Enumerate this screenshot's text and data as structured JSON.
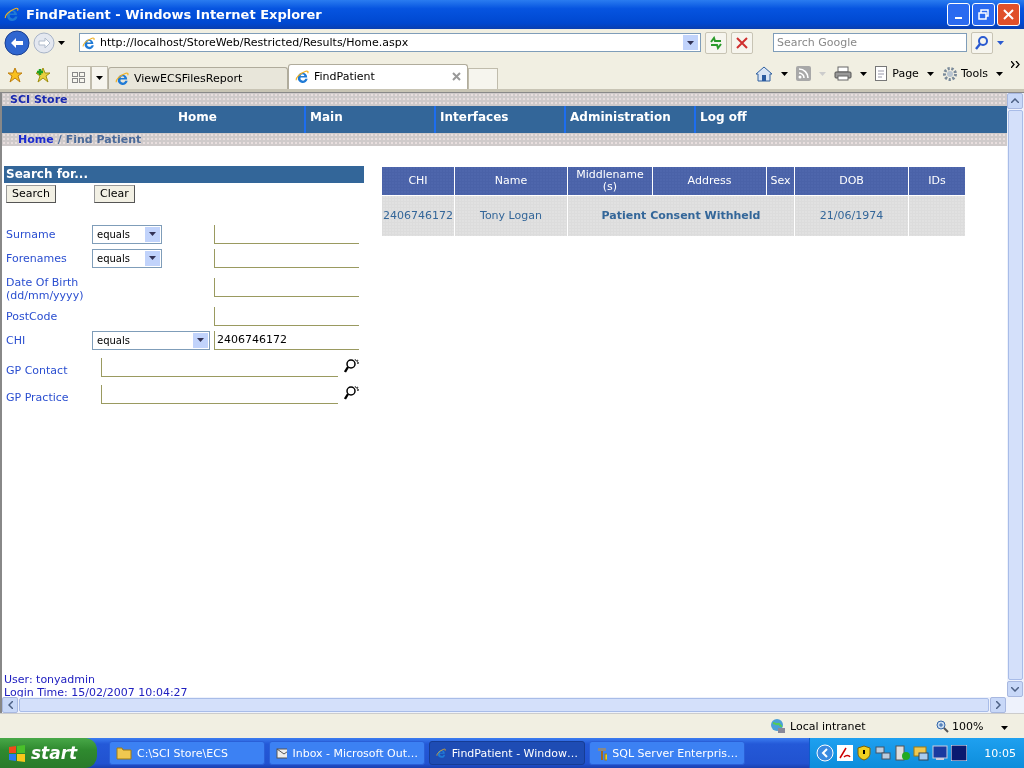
{
  "window": {
    "title": "FindPatient - Windows Internet Explorer"
  },
  "address_bar": {
    "url": "http://localhost/StoreWeb/Restricted/Results/Home.aspx"
  },
  "search_box": {
    "placeholder": "Search Google"
  },
  "tabs": [
    {
      "label": "ViewECSFilesReport",
      "selected": false
    },
    {
      "label": "FindPatient",
      "selected": true
    }
  ],
  "command_bar": {
    "page": "Page",
    "tools": "Tools"
  },
  "site": {
    "title": "SCI Store",
    "nav": [
      "Home",
      "Main",
      "Interfaces",
      "Administration",
      "Log off"
    ],
    "breadcrumb": {
      "link": "Home",
      "separator": "/",
      "current": "Find Patient"
    }
  },
  "search_panel": {
    "title": "Search for...",
    "buttons": [
      "Search",
      "Clear"
    ],
    "fields": [
      {
        "kind": "operator",
        "label": "Surname",
        "operator": "equals"
      },
      {
        "kind": "operator",
        "label": "Forenames",
        "operator": "equals"
      },
      {
        "kind": "plain",
        "label": "Date Of Birth (dd/mm/yyyy)"
      },
      {
        "kind": "plain",
        "label": "PostCode"
      },
      {
        "kind": "operator-wide",
        "label": "CHI",
        "operator": "equals",
        "value": "2406746172"
      },
      {
        "kind": "lookup",
        "label": "GP Contact"
      },
      {
        "kind": "lookup",
        "label": "GP Practice"
      }
    ]
  },
  "results": {
    "columns": [
      "CHI",
      "Name",
      "Middlename (s)",
      "Address",
      "Sex",
      "DOB",
      "IDs"
    ],
    "rows": [
      {
        "chi": "2406746172",
        "name": "Tony Logan",
        "notice": "Patient Consent Withheld",
        "dob": "21/06/1974"
      }
    ]
  },
  "footer": {
    "user": "User: tonyadmin",
    "login": "Login Time: 15/02/2007 10:04:27"
  },
  "status_bar": {
    "zone": "Local intranet",
    "zoom": "100%"
  },
  "taskbar": {
    "start": "start",
    "tasks": [
      {
        "label": "C:\\SCI Store\\ECS",
        "kind": "folder",
        "selected": false
      },
      {
        "label": "Inbox - Microsoft Out…",
        "kind": "mail",
        "selected": false
      },
      {
        "label": "FindPatient - Window…",
        "kind": "browser",
        "selected": true
      },
      {
        "label": "SQL Server Enterpris…",
        "kind": "tools",
        "selected": false
      }
    ],
    "clock": "10:05"
  }
}
